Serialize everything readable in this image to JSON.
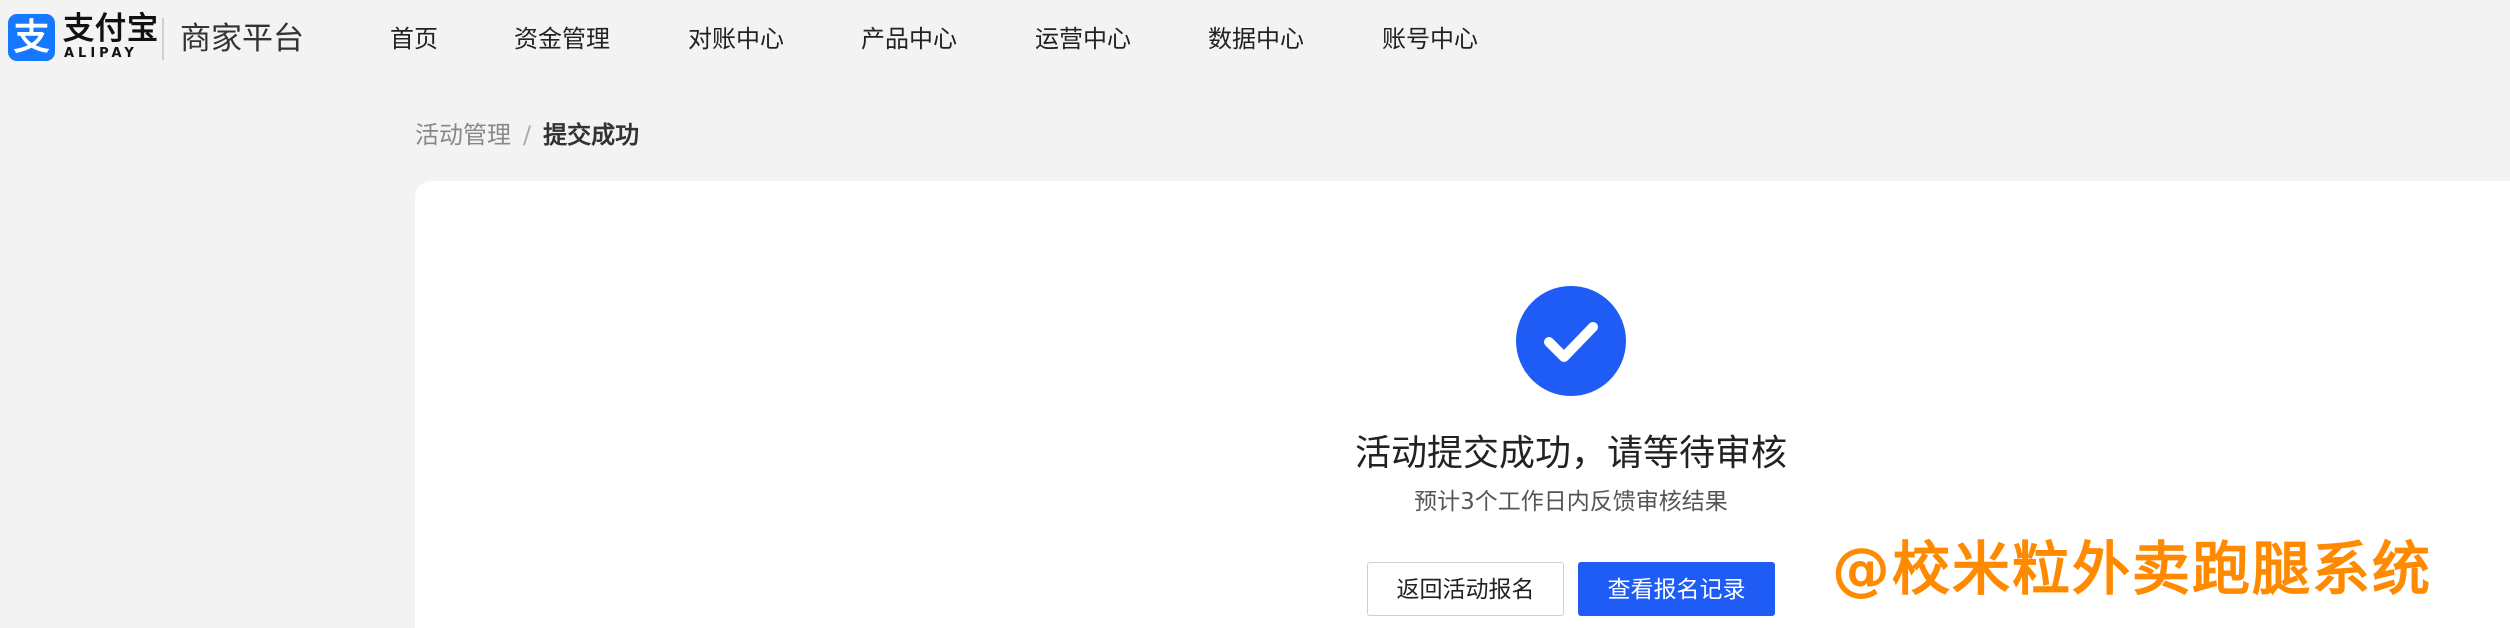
{
  "brand": {
    "logo_glyph": "支",
    "name_cn": "支付宝",
    "name_en": "ALIPAY",
    "platform": "商家平台",
    "brand_color": "#1677ff"
  },
  "nav": {
    "items": [
      {
        "label": "首页"
      },
      {
        "label": "资金管理"
      },
      {
        "label": "对账中心"
      },
      {
        "label": "产品中心"
      },
      {
        "label": "运营中心"
      },
      {
        "label": "数据中心"
      },
      {
        "label": "账号中心"
      }
    ]
  },
  "breadcrumb": {
    "parent": "活动管理",
    "separator": "/",
    "current": "提交成功"
  },
  "result": {
    "icon": "check-circle-icon",
    "accent_color": "#1f5bf5",
    "title": "活动提交成功，请等待审核",
    "subtitle": "预计3个工作日内反馈审核结果"
  },
  "actions": {
    "back_label": "返回活动报名",
    "records_label": "查看报名记录"
  },
  "watermark": {
    "text": "@校米粒外卖跑腿系统",
    "color": "#ff8a00"
  }
}
